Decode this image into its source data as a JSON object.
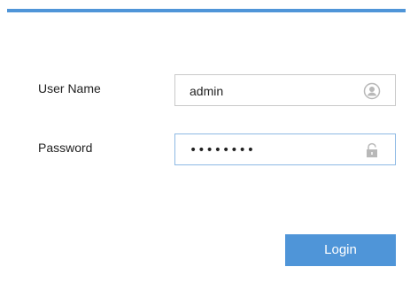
{
  "form": {
    "username": {
      "label": "User Name",
      "value": "admin",
      "icon": "user-icon"
    },
    "password": {
      "label": "Password",
      "value": "••••••••",
      "icon": "lock-icon"
    }
  },
  "actions": {
    "login_label": "Login"
  },
  "colors": {
    "accent": "#4f95d8",
    "input_border": "#c9c9c9",
    "focus_border": "#8db9e4",
    "icon_gray": "#b8b8b8"
  }
}
